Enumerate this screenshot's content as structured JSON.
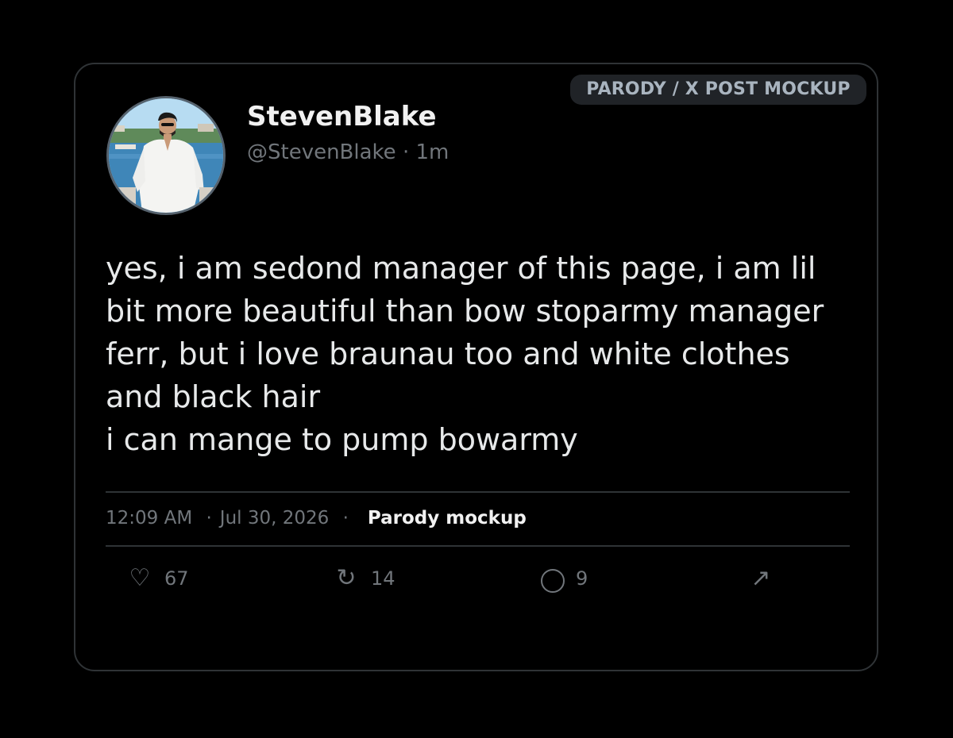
{
  "badge": "PARODY / X POST MOCKUP",
  "user": {
    "display_name": "StevenBlake",
    "handle": "@StevenBlake",
    "separator": "·",
    "time_ago": "1m",
    "avatar_icon": "profile-photo"
  },
  "post": {
    "lines": [
      "yes, i am sedond manager of this page, i am lil",
      "bit more beautiful than bow stoparmy manager",
      "ferr, but i love braunau too and white clothes",
      "and black hair",
      "i can mange to pump bowarmy"
    ]
  },
  "meta": {
    "time": "12:09 AM",
    "date": "Jul 30, 2026",
    "separator": "·",
    "source": "Parody mockup"
  },
  "actions": {
    "like": {
      "icon": "heart-icon",
      "glyph": "♡",
      "count": "67"
    },
    "retweet": {
      "icon": "retweet-icon",
      "glyph": "↻",
      "count": "14"
    },
    "reply": {
      "icon": "reply-icon",
      "count": "9"
    },
    "share": {
      "icon": "share-icon",
      "glyph": "↗"
    }
  },
  "colors": {
    "background": "#000000",
    "card_border": "#2f3336",
    "text_primary": "#e7e9ea",
    "text_secondary": "#71767b",
    "badge_bg": "#202327"
  }
}
